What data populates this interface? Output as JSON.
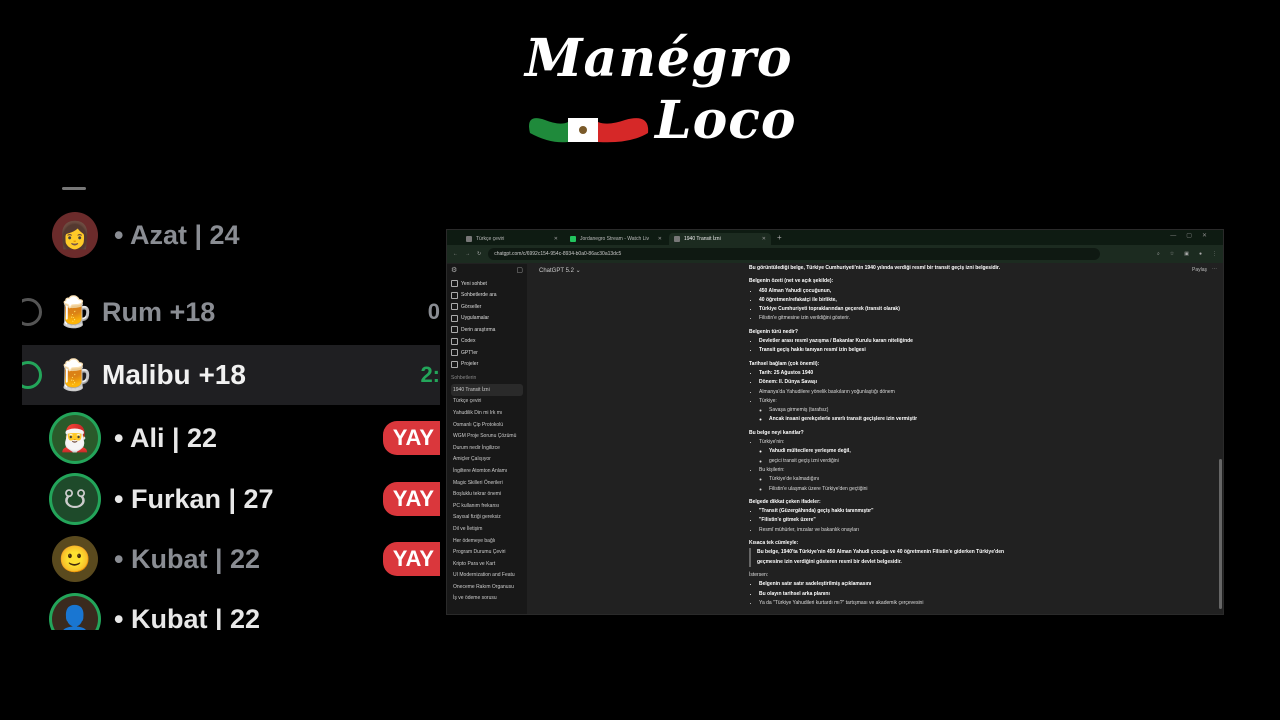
{
  "logo": {
    "line1": "Manégro",
    "line2": "Loco"
  },
  "voice_list": [
    {
      "name": "• Azat | 24",
      "style": "dim"
    },
    {
      "name": "Rum +18",
      "emoji": "🍺",
      "right": "0",
      "style": "channel"
    },
    {
      "name": "Malibu +18",
      "emoji": "🍺",
      "right": "2:",
      "style": "active"
    },
    {
      "name": "• Ali | 22",
      "badge": "YAY",
      "avatar": "🎅"
    },
    {
      "name": "• Furkan | 27",
      "badge": "YAY",
      "avatar": "☋"
    },
    {
      "name": "• Kubat | 22",
      "badge": "YAY",
      "style": "dim",
      "avatar": "🙂"
    },
    {
      "name": "• Kubat | 22",
      "avatar": "👤"
    }
  ],
  "browser": {
    "tabs": [
      {
        "title": "Türkçe çeviri",
        "active": false
      },
      {
        "title": "Jordanegro Stream - Watch Liv",
        "active": false
      },
      {
        "title": "1940 Transit İzni",
        "active": true
      }
    ],
    "url": "chatgpt.com/c/6992c154-954c-8934-b0a0-86ac30a13dc5",
    "model": "ChatGPT 5.2 ⌄",
    "share": "Paylaş",
    "sidebar": {
      "nav": [
        "Yeni sohbet",
        "Sohbetlerde ara",
        "Görseller",
        "Uygulamalar",
        "Derin araştırma",
        "Codex",
        "GPT'ler",
        "Projeler"
      ],
      "section": "Sohbetlerin",
      "chats": [
        "1940 Transit İzni",
        "Türkçe çeviri",
        "Yahudilik Din mi Irk mı",
        "Osmanlı Çip Protokolü",
        "WGM Proje Sorunu Çözümü",
        "Durum nedir İngilizce",
        "Amiçler Çalışıyor",
        "İngiltere Atomton Anlamı",
        "Magic Skilleri Önerileri",
        "Boşluklu tekrar önemi",
        "PC kullanım frekansı",
        "Sayısal fiziği gereksiz",
        "Dil ve İletişim",
        "Her ödemeye bağlı",
        "Program Durumu Çeviri",
        "Kripto Para ve Kart",
        "UI Modernization and Featu",
        "Oneceme Rakım Organusu",
        "İş ve ödeme sorusu"
      ]
    },
    "answer": {
      "intro": "Bu görüntülediği belge, Türkiye Cumhuriyeti'nin 1940 yılında verdiği resmî bir transit geçiş izni belgesidir.",
      "s1_title": "Belgenin özeti (net ve açık şekilde):",
      "s1_items": [
        "450 Alman Yahudi çocuğunun,",
        "40 öğretmen/refakatçi ile birlikte,",
        "Türkiye Cumhuriyeti topraklarından geçerek (transit olarak)",
        "Filistin'e gitmesine izin verildiğini gösterir."
      ],
      "s2_title": "Belgenin türü nedir?",
      "s2_items": [
        "Devletler arası resmî yazışma / Bakanlar Kurulu kararı niteliğinde",
        "Transit geçiş hakkı tanıyan resmî izin belgesi"
      ],
      "s3_title": "Tarihsel bağlam (çok önemli):",
      "s3_items": [
        "Tarih: 25 Ağustos 1940",
        "Dönem: II. Dünya Savaşı",
        "Almanya'da Yahudilere yönelik baskıların yoğunlaştığı dönem",
        "Türkiye:"
      ],
      "s3_sub": [
        "Savaşa girmemiş (tarafsız)",
        "Ancak insani gerekçelerle sınırlı transit geçişlere izin vermiştir"
      ],
      "s4_title": "Bu belge neyi kanıtlar?",
      "s4_a": "Türkiye'nin:",
      "s4_a_sub": [
        "Yahudi mültecilere yerleşme değil,",
        "geçici transit geçiş izni verdiğini"
      ],
      "s4_b": "Bu kişilerin:",
      "s4_b_sub": [
        "Türkiye'de kalmadığını",
        "Filistin'e ulaşmak üzere Türkiye'den geçtiğini"
      ],
      "s5_title": "Belgede dikkat çeken ifadeler:",
      "s5_items": [
        "\"Transit (Güzergâhında) geçiş hakkı tanınmıştır\"",
        "\"Filistin'e gitmek üzere\"",
        "Resmî mühürler, imzalar ve bakanlık onayları"
      ],
      "s6_title": "Kısaca tek cümleyle:",
      "s6_quote": "Bu belge, 1940'ta Türkiye'nin 450 Alman Yahudi çocuğu ve 40 öğretmenin Filistin'e giderken Türkiye'den geçmesine izin verdiğini gösteren resmî bir devlet belgesidir.",
      "s7_title": "İstersen:",
      "s7_items": [
        "Belgenin satır satır sadeleştirilmiş açıklamasını",
        "Bu olayın tarihsel arka planını",
        "Ya da \"Türkiye Yahudileri kurtardı mı?\" tartışması ve akademik çerçevesini"
      ]
    }
  }
}
